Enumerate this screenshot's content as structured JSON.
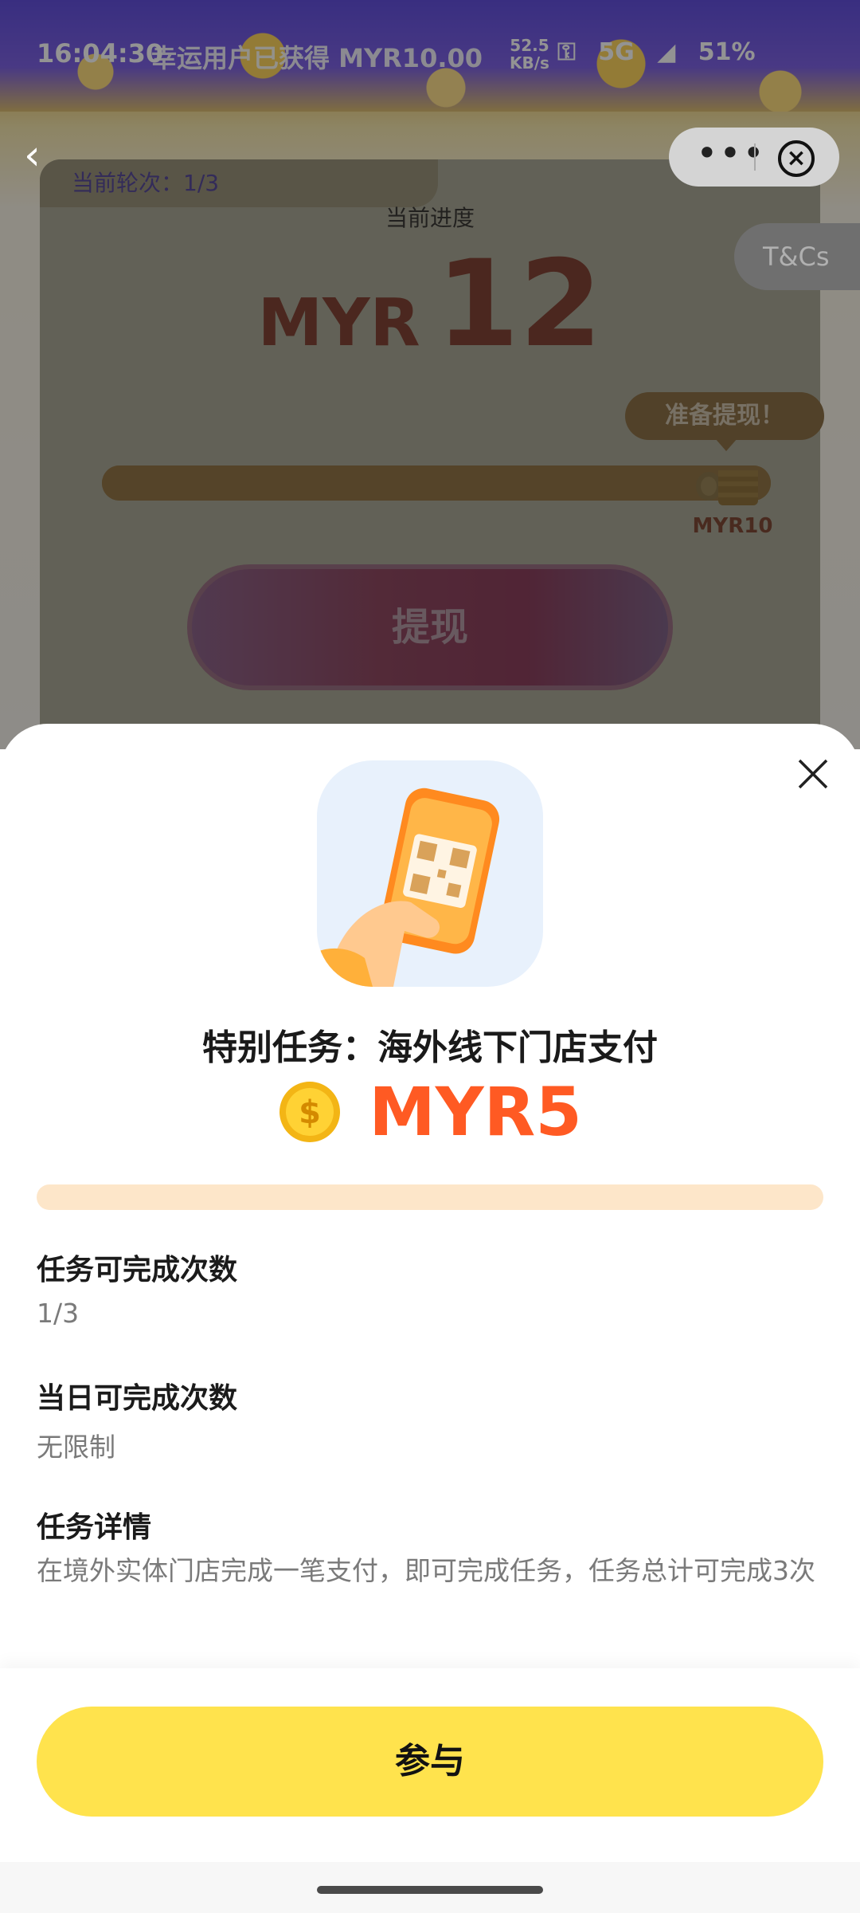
{
  "status_bar": {
    "time": "16:04:30",
    "banner": "幸运用户已获得 MYR10.00",
    "speed": "52.5",
    "speed_unit": "KB/s",
    "network": "5G",
    "battery": "51%"
  },
  "header": {
    "tnc_label": "T&Cs"
  },
  "progress_card": {
    "round_label": "当前轮次：1/3",
    "progress_label": "当前进度",
    "currency": "MYR",
    "amount": "12",
    "ready_label": "准备提现！",
    "target_label": "MYR10",
    "fill_fraction": 1.0,
    "withdraw_label": "提现"
  },
  "task_sheet": {
    "title": "特别任务：海外线下门店支付",
    "reward": "MYR5",
    "reward_color": "#ff5a23",
    "info": [
      {
        "label": "任务可完成次数",
        "value": "1/3"
      },
      {
        "label": "当日可完成次数",
        "value": "无限制"
      },
      {
        "label": "任务详情",
        "value": "在境外实体门店完成一笔支付，即可完成任务，任务总计可完成3次"
      }
    ],
    "join_label": "参与",
    "join_color": "#ffe34d"
  },
  "icons": [
    "back-icon",
    "more-icon",
    "close-circle-icon",
    "close-icon",
    "coin-stack-icon",
    "phone-scan-icon",
    "coin-icon"
  ]
}
